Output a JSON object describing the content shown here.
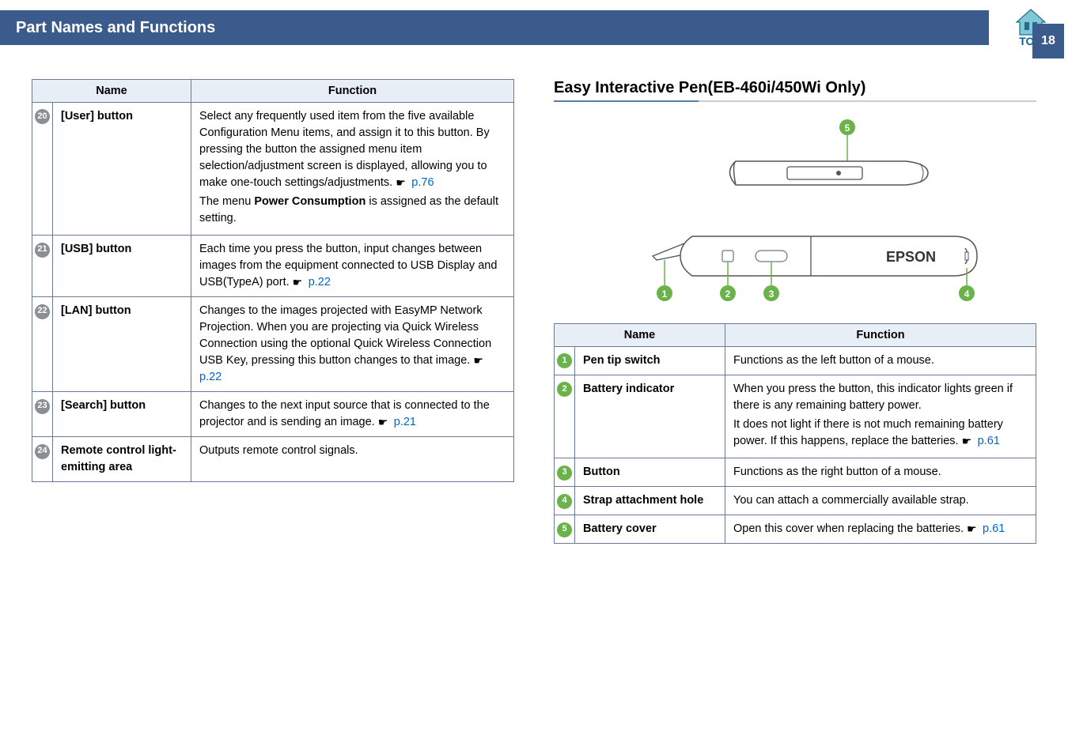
{
  "header": {
    "title": "Part Names and Functions",
    "top_label": "TOP",
    "page_number": "18"
  },
  "left_table": {
    "headers": [
      "Name",
      "Function"
    ],
    "rows": [
      {
        "num": "20",
        "name": "[User] button",
        "func_parts": [
          "Select any frequently used item from the five available Configuration Menu items, and assign it to this button. By pressing the button the assigned menu item selection/adjustment screen is displayed, allowing you to make one-touch settings/adjustments. ",
          "p.76",
          "The menu ",
          "Power Consumption",
          " is assigned as the default setting."
        ]
      },
      {
        "num": "21",
        "name": "[USB] button",
        "func_parts": [
          "Each time you press the button, input changes between images from the equipment connected to USB Display and USB(TypeA) port. ",
          "p.22"
        ]
      },
      {
        "num": "22",
        "name": "[LAN] button",
        "func_parts": [
          "Changes to the images projected with EasyMP Network Projection. When you are projecting via Quick Wireless Connection using the optional Quick Wireless Connection USB Key, pressing this button changes to that image. ",
          "p.22"
        ]
      },
      {
        "num": "23",
        "name": "[Search] button",
        "func_parts": [
          "Changes to the next input source that is connected to the projector and is sending an image. ",
          "p.21"
        ]
      },
      {
        "num": "24",
        "name": "Remote control light-emitting area",
        "func_parts": [
          "Outputs remote control signals."
        ]
      }
    ]
  },
  "right_section": {
    "title": "Easy Interactive Pen(EB-460i/450Wi Only)",
    "epson_label": "EPSON"
  },
  "right_table": {
    "headers": [
      "Name",
      "Function"
    ],
    "rows": [
      {
        "num": "1",
        "name": "Pen tip switch",
        "func_parts": [
          "Functions as the left button of a mouse."
        ]
      },
      {
        "num": "2",
        "name": "Battery indicator",
        "func_parts": [
          "When you press the button, this indicator lights green if there is any remaining battery power.",
          "It does not light if there is not much remaining battery power. If this happens, replace the batteries. ",
          "p.61"
        ]
      },
      {
        "num": "3",
        "name": "Button",
        "func_parts": [
          "Functions as the right button of a mouse."
        ]
      },
      {
        "num": "4",
        "name": "Strap attachment hole",
        "func_parts": [
          "You can attach a commercially available strap."
        ]
      },
      {
        "num": "5",
        "name": "Battery cover",
        "func_parts": [
          "Open this cover when replacing the batteries. ",
          "p.61"
        ]
      }
    ]
  }
}
